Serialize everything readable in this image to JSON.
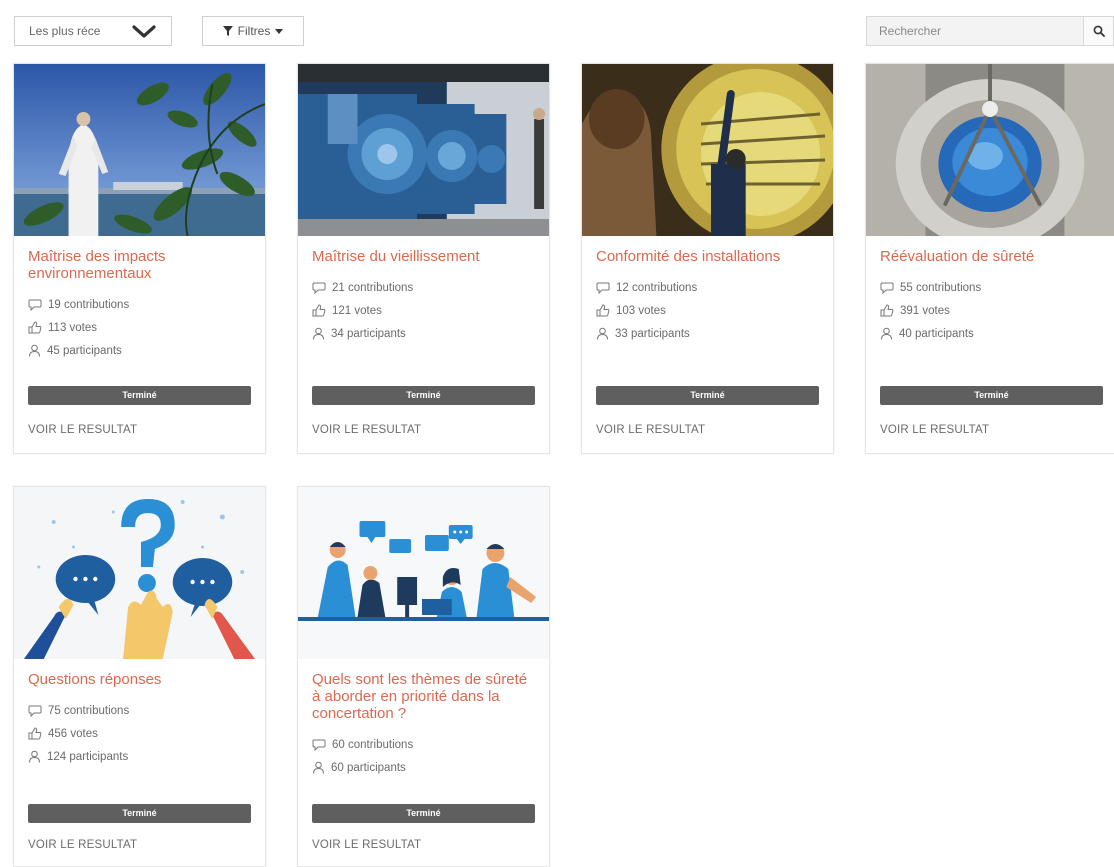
{
  "toolbar": {
    "sort_value": "Les plus réce",
    "filter_label": "Filtres",
    "search_placeholder": "Rechercher"
  },
  "icons": {
    "sort": "chevron-down-icon",
    "filter": "funnel-icon",
    "search": "magnifier-icon",
    "contributions": "speech-bubble-icon",
    "votes": "thumbs-up-icon",
    "participants": "person-icon"
  },
  "colors": {
    "title": "#d96a4f",
    "status_bar": "#5f5f5f",
    "accent_blue": "#1e88c8"
  },
  "cards": [
    {
      "title": "Maîtrise des impacts environnementaux",
      "contributions": "19 contributions",
      "votes": "113 votes",
      "participants": "45 participants",
      "status": "Terminé",
      "action": "VOIR LE RESULTAT"
    },
    {
      "title": "Maîtrise du vieillissement",
      "contributions": "21 contributions",
      "votes": "121 votes",
      "participants": "34 participants",
      "status": "Terminé",
      "action": "VOIR LE RESULTAT"
    },
    {
      "title": "Conformité des installations",
      "contributions": "12 contributions",
      "votes": "103 votes",
      "participants": "33 participants",
      "status": "Terminé",
      "action": "VOIR LE RESULTAT"
    },
    {
      "title": "Réévaluation de sûreté",
      "contributions": "55 contributions",
      "votes": "391 votes",
      "participants": "40 participants",
      "status": "Terminé",
      "action": "VOIR LE RESULTAT"
    },
    {
      "title": "Questions réponses",
      "contributions": "75 contributions",
      "votes": "456 votes",
      "participants": "124 participants",
      "status": "Terminé",
      "action": "VOIR LE RESULTAT"
    },
    {
      "title": "Quels sont les thèmes de sûreté à aborder en priorité dans la concertation ?",
      "contributions": "60 contributions",
      "participants": "60 participants",
      "status": "Terminé",
      "action": "VOIR LE RESULTAT"
    }
  ]
}
